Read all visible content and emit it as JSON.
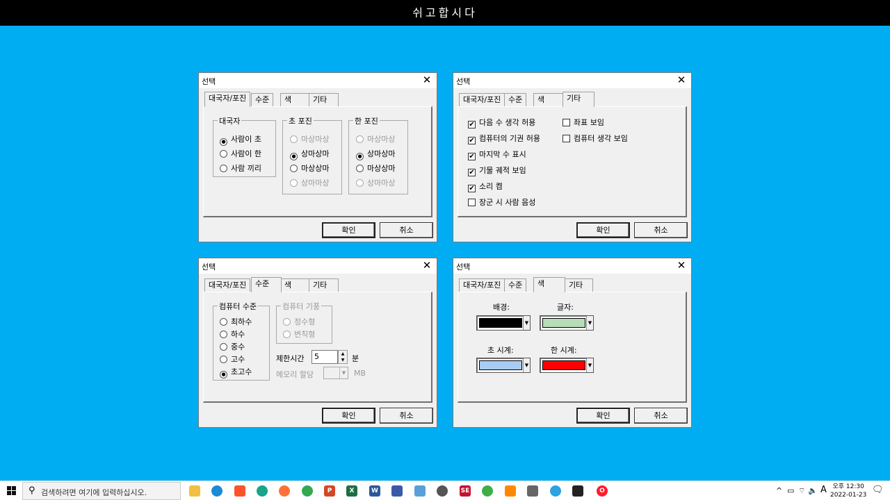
{
  "window_title": "쉬고합시다",
  "dialogs": {
    "d1": {
      "title": "선택",
      "tabs": [
        "대국자/포진",
        "수준",
        "색",
        "기타"
      ],
      "players": {
        "legend": "대국자",
        "options": [
          "사람이 초",
          "사람이 한",
          "사람 끼리"
        ]
      },
      "cho": {
        "legend": "초 포진",
        "options": [
          "마상마상",
          "상마상마",
          "마상상마",
          "상마마상"
        ]
      },
      "han": {
        "legend": "한 포진",
        "options": [
          "마상마상",
          "상마상마",
          "마상상마",
          "상마마상"
        ]
      },
      "ok": "확인",
      "cancel": "취소"
    },
    "d2": {
      "title": "선택",
      "tabs": [
        "대국자/포진",
        "수준",
        "색",
        "기타"
      ],
      "checks": [
        {
          "label": "다음 수 생각 허용",
          "checked": true
        },
        {
          "label": "컴퓨터의 기권 허용",
          "checked": true
        },
        {
          "label": "마지막 수 표시",
          "checked": true
        },
        {
          "label": "기물 궤적 보임",
          "checked": true
        },
        {
          "label": "소리 켬",
          "checked": true
        },
        {
          "label": "장군 시 사람 음성",
          "checked": false
        },
        {
          "label": "좌표 보임",
          "checked": false
        },
        {
          "label": "컴퓨터 생각 보임",
          "checked": false
        }
      ],
      "ok": "확인",
      "cancel": "취소"
    },
    "d3": {
      "title": "선택",
      "tabs": [
        "대국자/포진",
        "수준",
        "색",
        "기타"
      ],
      "level": {
        "legend": "컴퓨터 수준",
        "options": [
          "최하수",
          "하수",
          "중수",
          "고수",
          "초고수"
        ]
      },
      "style": {
        "legend": "컴퓨터 기풍",
        "options": [
          "정수형",
          "변칙형"
        ]
      },
      "time_label": "제한시간",
      "time_value": "5",
      "time_unit": "분",
      "mem_label": "메모리 할당",
      "mem_unit": "MB",
      "ok": "확인",
      "cancel": "취소"
    },
    "d4": {
      "title": "선택",
      "tabs": [
        "대국자/포진",
        "수준",
        "색",
        "기타"
      ],
      "bg_label": "배경:",
      "text_label": "글자:",
      "cho_clock_label": "초 시계:",
      "han_clock_label": "한 시계:",
      "colors": {
        "bg": "#000000",
        "text": "#b8dcb8",
        "cho_clock": "#a8cdf5",
        "han_clock": "#ff0000"
      },
      "ok": "확인",
      "cancel": "취소"
    }
  },
  "taskbar": {
    "search_placeholder": "검색하려면 여기에 입력하십시오.",
    "ime": "A",
    "time": "오후 12:30",
    "date": "2022-01-23"
  }
}
